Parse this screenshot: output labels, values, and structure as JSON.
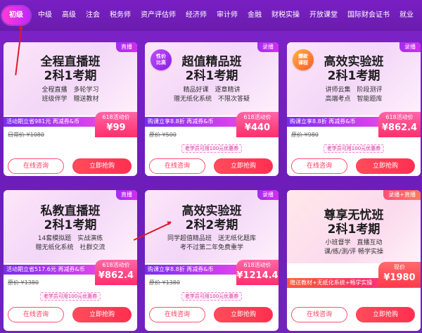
{
  "nav": {
    "items": [
      "初级",
      "中级",
      "高级",
      "注会",
      "税务师",
      "资产评估师",
      "经济师",
      "审计师",
      "金融",
      "财税实操",
      "开放课堂",
      "国际财会证书",
      "就业"
    ],
    "active_index": 0
  },
  "cards": [
    {
      "tag": "直播",
      "badge": "",
      "title1": "全程直播班",
      "title2": "2科1考期",
      "feat1": "全程直播　多轮学习",
      "feat2": "班级伴学　赠送教材",
      "promo": "活动期立省981元 再减券&币",
      "orig": "日常价 ¥1080",
      "price_label": "618活动价",
      "price": "¥99",
      "coupon": "",
      "consult": "在线咨询",
      "buy": "立即抢购"
    },
    {
      "tag": "录播",
      "badge": "性价\n比高",
      "title1": "超值精品班",
      "title2": "2科1考期",
      "feat1": "精品好课　逐章精讲",
      "feat2": "赠无纸化系统　不限次答疑",
      "promo": "购课立享8.8折 再减券&币",
      "orig": "原价 ¥500",
      "price_label": "618活动价",
      "price": "¥440",
      "coupon": "老学员可用100元优惠券",
      "consult": "在线咨询",
      "buy": "立即抢购"
    },
    {
      "tag": "录播",
      "badge": "爆款\n课程",
      "title1": "高效实验班",
      "title2": "2科1考期",
      "feat1": "讲师云集　阶段测评",
      "feat2": "高端考点　智能题库",
      "promo": "购课立享8.8折 再减券&币",
      "orig": "原价 ¥980",
      "price_label": "618活动价",
      "price": "¥862.4",
      "coupon": "老学员可用100元优惠券",
      "consult": "在线咨询",
      "buy": "立即抢购"
    },
    {
      "tag": "直播",
      "badge": "",
      "title1": "私教直播班",
      "title2": "2科1考期",
      "feat1": "14套模拟题　实战演练",
      "feat2": "赠无纸化系统　社群交流",
      "promo": "活动期立省517.6元 再减券&币",
      "orig": "原价 ¥1380",
      "price_label": "618活动价",
      "price": "¥862.4",
      "coupon": "老学员可用100元优惠券",
      "consult": "在线咨询",
      "buy": "立即抢购"
    },
    {
      "tag": "录播",
      "badge": "",
      "title1": "高效实验班",
      "title2": "2科2考期",
      "feat1": "同学超值精品班　送无纸化题库",
      "feat2": "考不过第二年免费重学",
      "promo": "购课立享8.8折 再减券&币",
      "orig": "原价 ¥1380",
      "price_label": "618活动价",
      "price": "¥1214.4",
      "coupon": "老学员可用100元优惠券",
      "consult": "在线咨询",
      "buy": "立即抢购"
    },
    {
      "tag": "录播+直播",
      "badge": "",
      "title1": "尊享无忧班",
      "title2": "2科1考期",
      "feat1": "小班督学　直播互动",
      "feat2": "课/练/测/评 畅学实操",
      "promo": "赠送教材+无纸化系统+畅学实操",
      "orig": "",
      "price_label": "现价",
      "price": "¥1980",
      "coupon": "",
      "consult": "在线咨询",
      "buy": "立即抢购"
    }
  ]
}
